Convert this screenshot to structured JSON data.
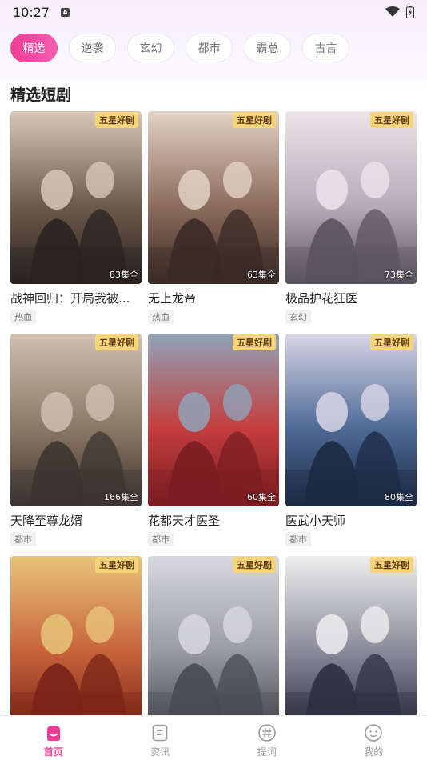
{
  "status_bar": {
    "time": "10:27",
    "notification_letter": "A"
  },
  "categories": [
    {
      "label": "精选",
      "active": true
    },
    {
      "label": "逆袭",
      "active": false
    },
    {
      "label": "玄幻",
      "active": false
    },
    {
      "label": "都市",
      "active": false
    },
    {
      "label": "霸总",
      "active": false
    },
    {
      "label": "古言",
      "active": false
    }
  ],
  "section_title": "精选短剧",
  "dramas": [
    {
      "title": "战神回归：开局我被...",
      "tag": "热血",
      "badge": "五星好剧",
      "episodes": "83集全",
      "palette": [
        "#2b2320",
        "#6d5a4c",
        "#d8c7b6"
      ]
    },
    {
      "title": "无上龙帝",
      "tag": "热血",
      "badge": "五星好剧",
      "episodes": "63集全",
      "palette": [
        "#3a2a26",
        "#8c6c5c",
        "#e3d2c6"
      ]
    },
    {
      "title": "极品护花狂医",
      "tag": "玄幻",
      "badge": "五星好剧",
      "episodes": "73集全",
      "palette": [
        "#5a5360",
        "#b9aab7",
        "#ede4ea"
      ]
    },
    {
      "title": "天降至尊龙婿",
      "tag": "都市",
      "badge": "五星好剧",
      "episodes": "166集全",
      "palette": [
        "#3d3530",
        "#8b7766",
        "#cfc0b0"
      ]
    },
    {
      "title": "花都天才医圣",
      "tag": "都市",
      "badge": "五星好剧",
      "episodes": "60集全",
      "palette": [
        "#7a1d22",
        "#c53d3d",
        "#8fa3b8"
      ]
    },
    {
      "title": "医武小天师",
      "tag": "都市",
      "badge": "五星好剧",
      "episodes": "80集全",
      "palette": [
        "#1c2a44",
        "#4e6a96",
        "#d9d6e6"
      ]
    },
    {
      "title": "",
      "tag": "",
      "badge": "五星好剧",
      "episodes": "",
      "palette": [
        "#7a2418",
        "#c8643a",
        "#e8c47a"
      ]
    },
    {
      "title": "",
      "tag": "",
      "badge": "五星好剧",
      "episodes": "",
      "palette": [
        "#4a4a52",
        "#9a9aa4",
        "#d8d8de"
      ]
    },
    {
      "title": "",
      "tag": "",
      "badge": "五星好剧",
      "episodes": "",
      "palette": [
        "#2e3040",
        "#8a8a9a",
        "#efefef"
      ]
    }
  ],
  "bottom_nav": [
    {
      "label": "首页",
      "icon": "home-icon",
      "active": true
    },
    {
      "label": "资讯",
      "icon": "news-icon",
      "active": false
    },
    {
      "label": "提词",
      "icon": "hashtag-icon",
      "active": false
    },
    {
      "label": "我的",
      "icon": "profile-icon",
      "active": false
    }
  ],
  "colors": {
    "accent": "#ee3d95",
    "badge_bg": "#f6d57a",
    "badge_text": "#5b3a12"
  }
}
